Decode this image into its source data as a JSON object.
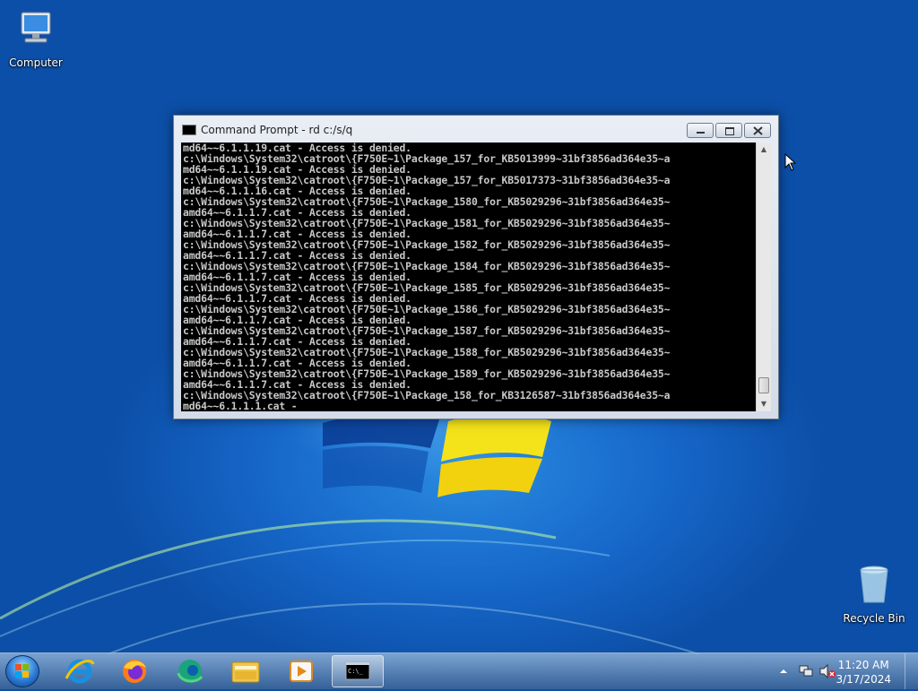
{
  "desktop": {
    "icons": [
      {
        "label": "Computer"
      },
      {
        "label": "Recycle Bin"
      }
    ]
  },
  "window": {
    "title": "Command Prompt - rd  c:/s/q",
    "console_lines": [
      "md64~~6.1.1.19.cat - Access is denied.",
      "c:\\Windows\\System32\\catroot\\{F750E~1\\Package_157_for_KB5013999~31bf3856ad364e35~a",
      "md64~~6.1.1.19.cat - Access is denied.",
      "c:\\Windows\\System32\\catroot\\{F750E~1\\Package_157_for_KB5017373~31bf3856ad364e35~a",
      "md64~~6.1.1.16.cat - Access is denied.",
      "c:\\Windows\\System32\\catroot\\{F750E~1\\Package_1580_for_KB5029296~31bf3856ad364e35~",
      "amd64~~6.1.1.7.cat - Access is denied.",
      "c:\\Windows\\System32\\catroot\\{F750E~1\\Package_1581_for_KB5029296~31bf3856ad364e35~",
      "amd64~~6.1.1.7.cat - Access is denied.",
      "c:\\Windows\\System32\\catroot\\{F750E~1\\Package_1582_for_KB5029296~31bf3856ad364e35~",
      "amd64~~6.1.1.7.cat - Access is denied.",
      "c:\\Windows\\System32\\catroot\\{F750E~1\\Package_1584_for_KB5029296~31bf3856ad364e35~",
      "amd64~~6.1.1.7.cat - Access is denied.",
      "c:\\Windows\\System32\\catroot\\{F750E~1\\Package_1585_for_KB5029296~31bf3856ad364e35~",
      "amd64~~6.1.1.7.cat - Access is denied.",
      "c:\\Windows\\System32\\catroot\\{F750E~1\\Package_1586_for_KB5029296~31bf3856ad364e35~",
      "amd64~~6.1.1.7.cat - Access is denied.",
      "c:\\Windows\\System32\\catroot\\{F750E~1\\Package_1587_for_KB5029296~31bf3856ad364e35~",
      "amd64~~6.1.1.7.cat - Access is denied.",
      "c:\\Windows\\System32\\catroot\\{F750E~1\\Package_1588_for_KB5029296~31bf3856ad364e35~",
      "amd64~~6.1.1.7.cat - Access is denied.",
      "c:\\Windows\\System32\\catroot\\{F750E~1\\Package_1589_for_KB5029296~31bf3856ad364e35~",
      "amd64~~6.1.1.7.cat - Access is denied.",
      "c:\\Windows\\System32\\catroot\\{F750E~1\\Package_158_for_KB3126587~31bf3856ad364e35~a",
      "md64~~6.1.1.1.cat -"
    ]
  },
  "taskbar": {
    "pinned": [
      {
        "icon": "internet-explorer-icon"
      },
      {
        "icon": "firefox-icon"
      },
      {
        "icon": "edge-icon"
      },
      {
        "icon": "file-explorer-icon"
      },
      {
        "icon": "media-player-icon"
      },
      {
        "icon": "command-prompt-icon"
      }
    ],
    "clock": {
      "time": "11:20 AM",
      "date": "3/17/2024"
    }
  },
  "colors": {
    "console_bg": "#000000",
    "console_fg": "#c8c8c8",
    "desktop": "#1667c9"
  }
}
